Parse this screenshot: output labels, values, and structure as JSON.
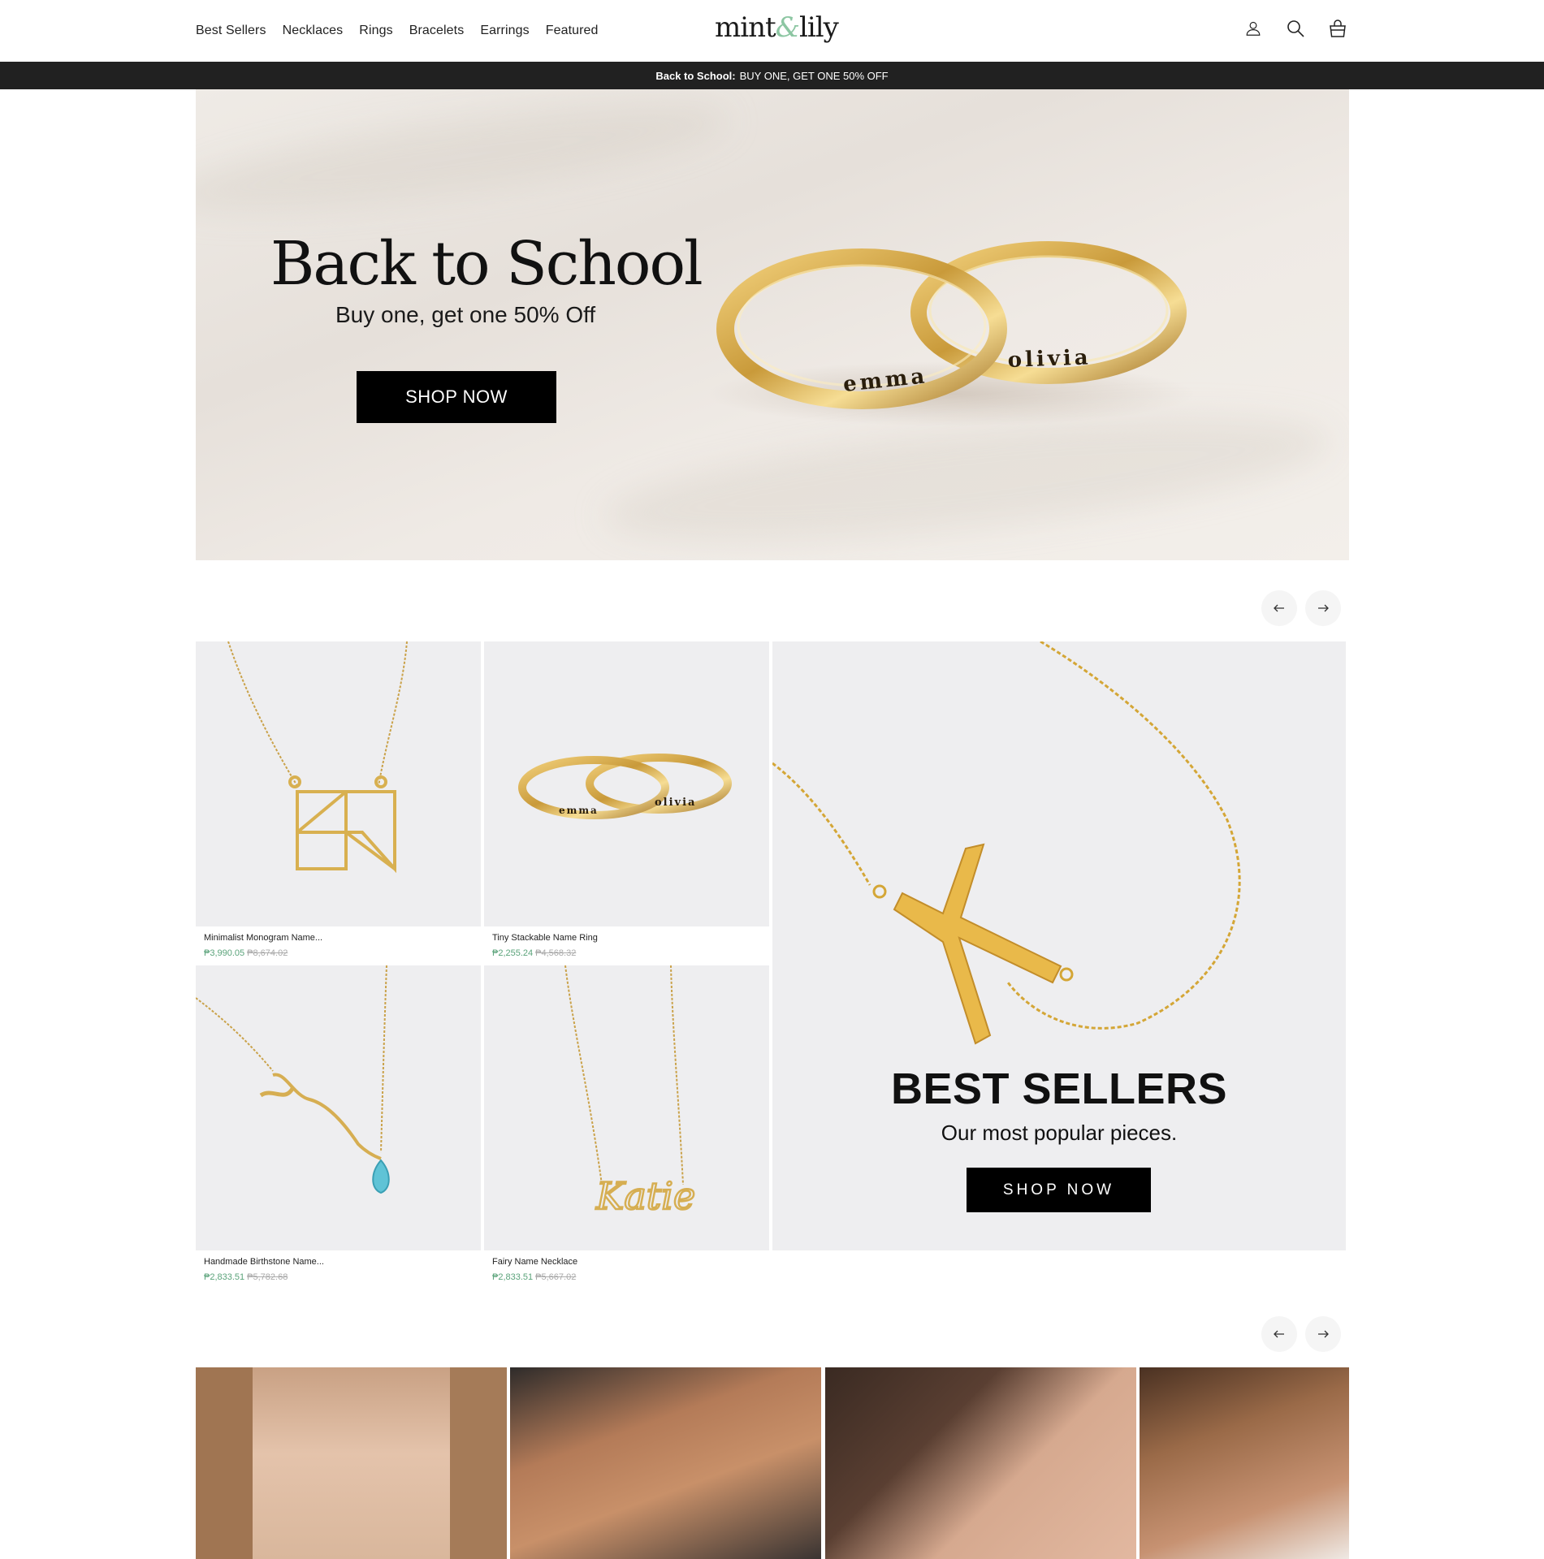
{
  "header": {
    "nav": [
      "Best Sellers",
      "Necklaces",
      "Rings",
      "Bracelets",
      "Earrings",
      "Featured"
    ],
    "logo_left": "mint",
    "logo_amp": "&",
    "logo_right": "lily",
    "icons": [
      "account-icon",
      "search-icon",
      "cart-icon"
    ]
  },
  "announcement": {
    "bold": "Back to School:",
    "text": "BUY ONE, GET ONE 50% OFF"
  },
  "hero": {
    "title": "Back to School",
    "subtitle": "Buy one, get one 50% Off",
    "button": "SHOP NOW",
    "ring_left_engraving": "emma",
    "ring_right_engraving": "olivia"
  },
  "products": [
    {
      "name": "Minimalist Monogram Name...",
      "price": "₱3,990.05",
      "was": "₱8,674.02"
    },
    {
      "name": "Tiny Stackable Name Ring",
      "price": "₱2,255.24",
      "was": "₱4,568.32"
    },
    {
      "name": "Handmade Birthstone Name...",
      "price": "₱2,833.51",
      "was": "₱5,782.68"
    },
    {
      "name": "Fairy Name Necklace",
      "price": "₱2,833.51",
      "was": "₱5,667.02"
    }
  ],
  "product_images": {
    "ring_left": "emma",
    "ring_right": "olivia",
    "script_name": "Katie"
  },
  "best_sellers": {
    "title": "BEST SELLERS",
    "subtitle": "Our most popular pieces.",
    "button": "SHOP NOW"
  },
  "colors": {
    "accent_green": "#5aa37a",
    "logo_amp": "#8cc6a2",
    "announcement_bg": "#212121",
    "gold": "#d8a83a"
  }
}
